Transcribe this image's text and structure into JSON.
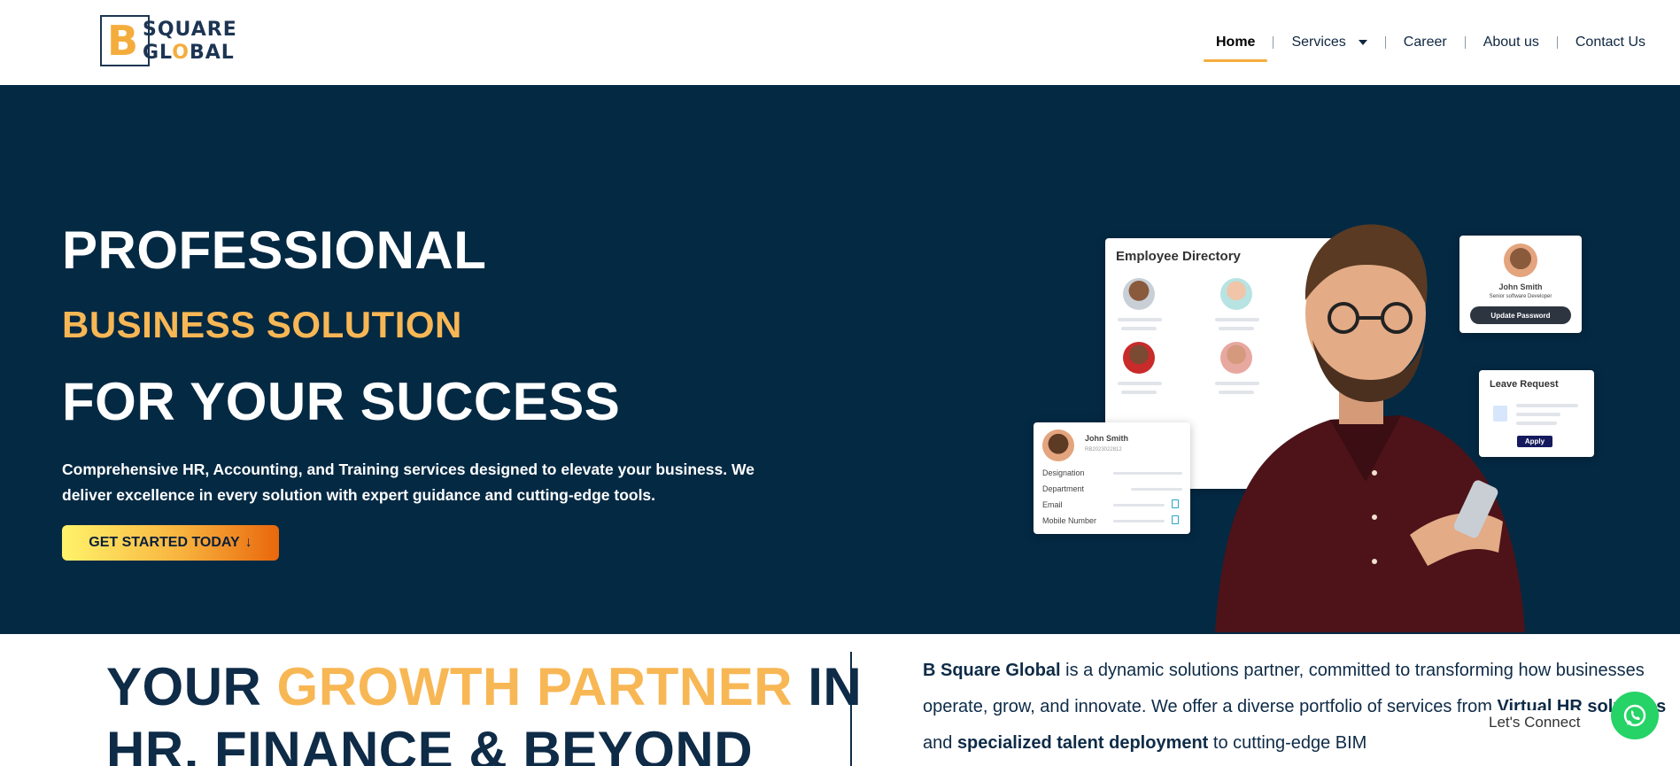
{
  "brand": {
    "logo_initial": "B",
    "logo_line1": "SQUARE",
    "logo_line2_a": "GL",
    "logo_line2_o": "O",
    "logo_line2_b": "BAL",
    "accent_color": "#f4ad3c",
    "navy_color": "#042943"
  },
  "nav": {
    "home": "Home",
    "services": "Services",
    "career": "Career",
    "about": "About us",
    "contact": "Contact Us"
  },
  "hero": {
    "line1": "PROFESSIONAL",
    "line2": "BUSINESS SOLUTION",
    "line3": "FOR YOUR SUCCESS",
    "description": "Comprehensive HR, Accounting, and Training services designed to elevate your business. We deliver excellence in every solution with expert guidance and cutting-edge tools.",
    "cta_label": "GET STARTED TODAY",
    "cta_arrow": "↓"
  },
  "illustration": {
    "directory_title": "Employee Directory",
    "profile_name": "John Smith",
    "profile_role": "Senior software Developer",
    "profile_button": "Update Password",
    "leave_title": "Leave Request",
    "leave_button": "Apply",
    "detail_name": "John Smith",
    "detail_id": "RB2023022812",
    "detail_fields": [
      "Designation",
      "Department",
      "Email",
      "Mobile Number"
    ]
  },
  "growth": {
    "w1": "YOUR ",
    "w2": "GROWTH PARTNER",
    "w3": " IN",
    "line2": "HR, FINANCE & BEYOND"
  },
  "about": {
    "brand": "B Square Global",
    "t1": " is a dynamic solutions partner, committed to transforming how businesses operate, grow, and innovate. We offer a diverse portfolio of services from ",
    "b1": "Virtual HR solutions",
    "t2": " and ",
    "b2": "specialized talent deployment",
    "t3": " to cutting-edge BIM"
  },
  "widget": {
    "label": "Let's Connect",
    "color": "#25d366"
  }
}
